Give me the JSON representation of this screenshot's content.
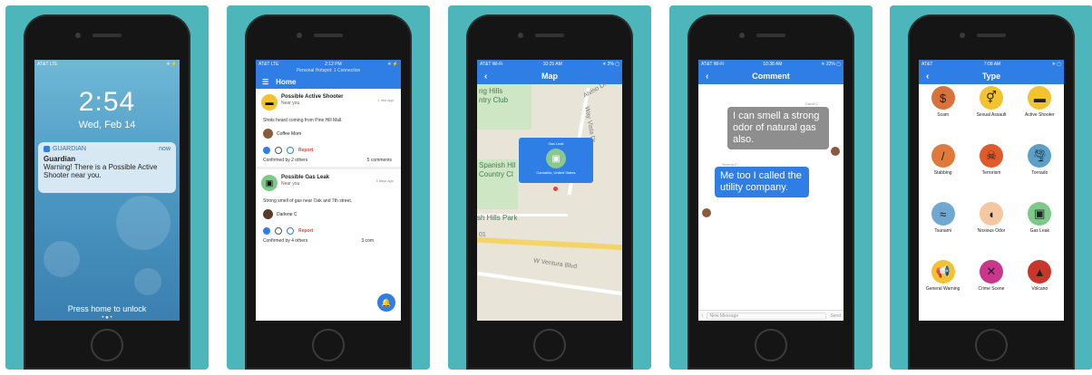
{
  "lock": {
    "status_left": "AT&T LTE",
    "status_right": "✳ ⚡",
    "time": "2:54",
    "date": "Wed, Feb 14",
    "notif_app": "GUARDIAN",
    "notif_when": "now",
    "notif_title": "Guardian",
    "notif_msg": "Warning! There is a Possible Active Shooter near you.",
    "press_home": "Press home to unlock"
  },
  "home": {
    "status_left": "AT&T LTE",
    "status_time": "2:12 PM",
    "status_right": "✳ ⚡",
    "hotspot": "Personal Hotspot: 1 Connection",
    "title": "Home",
    "menu_icon": "menu-icon",
    "cards": [
      {
        "title": "Possible Active Shooter",
        "sub": "Near you",
        "ago": "1 min ago",
        "desc": "Shots heard coming from Pine Hill Mall.",
        "user": "Coffee Mom",
        "report": "Report",
        "confirmed": "Confirmed by 2 others",
        "comments": "5 comments"
      },
      {
        "title": "Possible Gas Leak",
        "sub": "Near you",
        "ago": "3 days ago",
        "desc": "Strong smell of gas near Oak and 7th street.",
        "user": "Darlene C",
        "report": "Report",
        "confirmed": "Confirmed by 4 others",
        "comments": "3 com"
      }
    ]
  },
  "map": {
    "status_left": "AT&T Wi-Fi",
    "status_time": "10:25 AM",
    "status_right": "✳ 3% ▢",
    "title": "Map",
    "labels": [
      "ng Hills",
      "ntry Club",
      "Alviso Dr",
      "Spanish Hil",
      "Country Cl",
      "sh Hills Park",
      "W Ventura Blvd",
      "Way Vista Dr",
      "01"
    ],
    "popup_title": "Gas Leak",
    "popup_location": "Camarillo, United States"
  },
  "comment": {
    "status_left": "AT&T Wi-Fi",
    "status_time": "10:38 AM",
    "status_right": "✳ 22% ▢",
    "title": "Comment",
    "sender1": "David C",
    "msg1": "I can smell a strong odor of natural gas also.",
    "sender2": "Serena C",
    "msg2": "Me too I called the utility company.",
    "input_placeholder": "New Message",
    "send": "Send"
  },
  "type": {
    "status_left": "AT&T",
    "status_time": "7:08 AM",
    "status_right": "✳ ▢",
    "title": "Type",
    "items": [
      {
        "label": "Scam",
        "icon": "scam-icon",
        "glyph": "$",
        "color": "#d9713a"
      },
      {
        "label": "Sexual Assault",
        "icon": "gender-icon",
        "glyph": "⚥",
        "color": "#f2c230"
      },
      {
        "label": "Active Shooter",
        "icon": "gun-icon",
        "glyph": "▬",
        "color": "#f2c230"
      },
      {
        "label": "Stabbing",
        "icon": "knife-icon",
        "glyph": "/",
        "color": "#e07a3a"
      },
      {
        "label": "Terrorism",
        "icon": "terrorism-icon",
        "glyph": "☠",
        "color": "#e05a2a"
      },
      {
        "label": "Tornado",
        "icon": "tornado-icon",
        "glyph": "🌪",
        "color": "#5aa0c8"
      },
      {
        "label": "Tsunami",
        "icon": "wave-icon",
        "glyph": "≈",
        "color": "#6fa8d0"
      },
      {
        "label": "Noxious Odor",
        "icon": "nose-icon",
        "glyph": "◖",
        "color": "#f3c7a0"
      },
      {
        "label": "Gas Leak",
        "icon": "gas-tank-icon",
        "glyph": "▣",
        "color": "#7dc98a"
      },
      {
        "label": "General Warning",
        "icon": "megaphone-icon",
        "glyph": "📢",
        "color": "#f2c230"
      },
      {
        "label": "Crime Scene",
        "icon": "crime-tape-icon",
        "glyph": "✕",
        "color": "#c9368c"
      },
      {
        "label": "Volcano",
        "icon": "volcano-icon",
        "glyph": "▲",
        "color": "#c9362a"
      }
    ]
  }
}
